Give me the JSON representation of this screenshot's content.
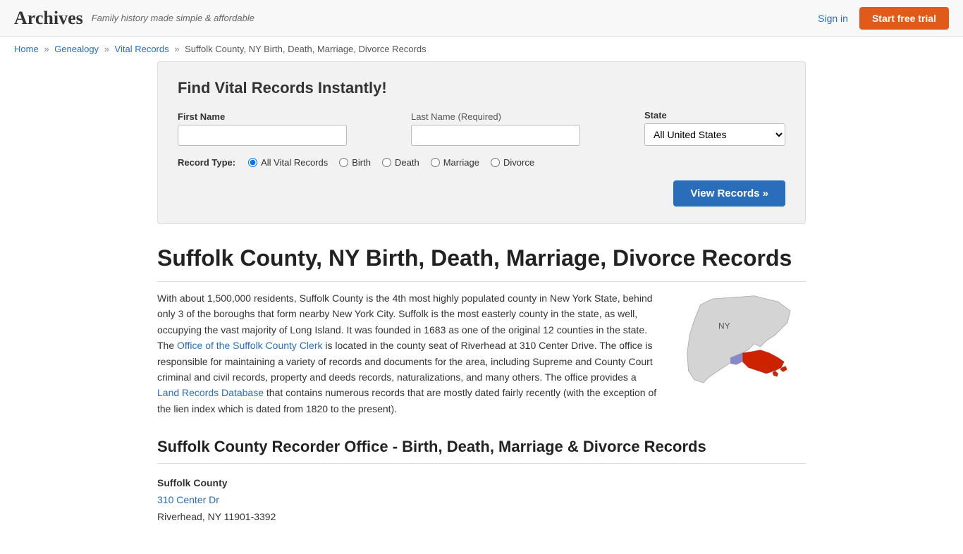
{
  "header": {
    "logo": "Archives",
    "tagline": "Family history made simple & affordable",
    "sign_in": "Sign in",
    "start_trial": "Start free trial"
  },
  "breadcrumb": {
    "home": "Home",
    "genealogy": "Genealogy",
    "vital_records": "Vital Records",
    "current": "Suffolk County, NY Birth, Death, Marriage, Divorce Records"
  },
  "search": {
    "title": "Find Vital Records Instantly!",
    "first_name_label": "First Name",
    "last_name_label": "Last Name",
    "last_name_required": "(Required)",
    "state_label": "State",
    "state_value": "All United States",
    "record_type_label": "Record Type:",
    "record_types": [
      {
        "id": "all",
        "label": "All Vital Records",
        "checked": true
      },
      {
        "id": "birth",
        "label": "Birth",
        "checked": false
      },
      {
        "id": "death",
        "label": "Death",
        "checked": false
      },
      {
        "id": "marriage",
        "label": "Marriage",
        "checked": false
      },
      {
        "id": "divorce",
        "label": "Divorce",
        "checked": false
      }
    ],
    "view_records_btn": "View Records »"
  },
  "page": {
    "title": "Suffolk County, NY Birth, Death, Marriage, Divorce Records",
    "description_p1": "With about 1,500,000 residents, Suffolk County is the 4th most highly populated county in New York State, behind only 3 of the boroughs that form nearby New York City. Suffolk is the most easterly county in the state, as well, occupying the vast majority of Long Island. It was founded in 1683 as one of the original 12 counties in the state. The ",
    "link1_text": "Office of the Suffolk County Clerk",
    "link1_url": "#",
    "description_p2": " is located in the county seat of Riverhead at 310 Center Drive. The office is responsible for maintaining a variety of records and documents for the area, including Supreme and County Court criminal and civil records, property and deeds records, naturalizations, and many others. The office provides a ",
    "link2_text": "Land Records Database",
    "link2_url": "#",
    "description_p3": " that contains numerous records that are mostly dated fairly recently (with the exception of the lien index which is dated from 1820 to the present).",
    "section2_title": "Suffolk County Recorder Office - Birth, Death, Marriage & Divorce Records",
    "address_name": "Suffolk County",
    "address_line1": "310 Center Dr",
    "address_line2": "Riverhead, NY 11901-3392"
  }
}
